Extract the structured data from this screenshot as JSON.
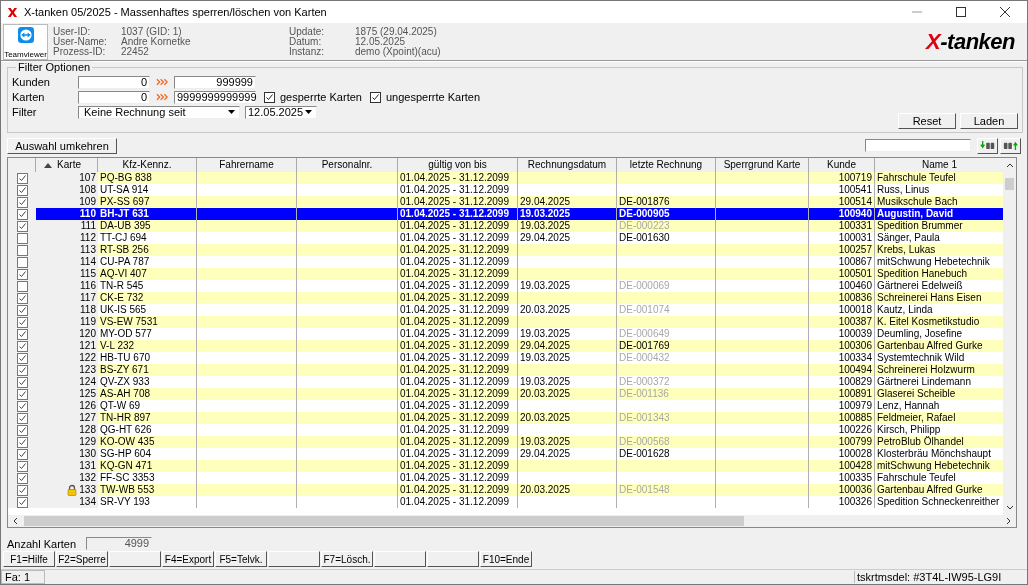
{
  "window": {
    "title": "X-tanken 05/2025 - Massenhaftes sperren/löschen von Karten"
  },
  "teamviewer": {
    "label": "Teamviewer"
  },
  "info": [
    {
      "label": "User-ID:",
      "value": "1037 (GID: 1)"
    },
    {
      "label": "User-Name:",
      "value": "Andre Kornetke"
    },
    {
      "label": "Prozess-ID:",
      "value": "22452"
    },
    {
      "label": "Update:",
      "value": "1875 (29.04.2025)"
    },
    {
      "label": "Datum:",
      "value": "12.05.2025"
    },
    {
      "label": "Instanz:",
      "value": "demo (Xpoint)(acu)"
    }
  ],
  "logo": {
    "mark": "X",
    "text": "-tanken"
  },
  "filter": {
    "title": "Filter Optionen",
    "kunden": {
      "label": "Kunden",
      "from": "0",
      "to": "999999"
    },
    "karten": {
      "label": "Karten",
      "from": "0",
      "to": "9999999999999"
    },
    "checks": [
      {
        "label": "gesperrte Karten",
        "checked": true
      },
      {
        "label": "ungesperrte Karten",
        "checked": true
      }
    ],
    "filter": {
      "label": "Filter",
      "value": "Keine Rechnung seit",
      "date": "12.05.2025"
    },
    "buttons": [
      "Reset",
      "Laden"
    ]
  },
  "invert_button": "Auswahl umkehren",
  "table": {
    "columns": [
      "Karte",
      "Kfz-Kennz.",
      "Fahrername",
      "Personalnr.",
      "gültig von bis",
      "Rechnungsdatum",
      "letzte Rechnung",
      "Sperrgrund Karte",
      "Kunde",
      "Name 1"
    ],
    "rows": [
      {
        "checked": true,
        "locked": false,
        "selected": false,
        "karte": "107",
        "kfz": "PQ-BG 838",
        "valid": "01.04.2025 - 31.12.2099",
        "kunde": "100719",
        "name": "Fahrschule Teufel"
      },
      {
        "checked": true,
        "locked": false,
        "selected": false,
        "karte": "108",
        "kfz": "UT-SA 914",
        "valid": "01.04.2025 - 31.12.2099",
        "kunde": "100541",
        "name": "Russ, Linus"
      },
      {
        "checked": true,
        "locked": false,
        "selected": false,
        "karte": "109",
        "kfz": "PX-SS 697",
        "valid": "01.04.2025 - 31.12.2099",
        "date": "29.04.2025",
        "invoice": "DE-001876",
        "stale": false,
        "kunde": "100514",
        "name": "Musikschule Bach"
      },
      {
        "checked": true,
        "locked": false,
        "selected": true,
        "karte": "110",
        "kfz": "BH-JT 631",
        "valid": "01.04.2025 - 31.12.2099",
        "date": "19.03.2025",
        "invoice": "DE-000905",
        "stale": false,
        "kunde": "100940",
        "name": "Augustin, David"
      },
      {
        "checked": true,
        "locked": false,
        "selected": false,
        "karte": "111",
        "kfz": "DA-UB 395",
        "valid": "01.04.2025 - 31.12.2099",
        "date": "19.03.2025",
        "invoice": "DE-000223",
        "stale": true,
        "kunde": "100331",
        "name": "Spedition Brummer"
      },
      {
        "checked": false,
        "locked": false,
        "selected": false,
        "karte": "112",
        "kfz": "TT-CJ 694",
        "valid": "01.04.2025 - 31.12.2099",
        "date": "29.04.2025",
        "invoice": "DE-001630",
        "stale": false,
        "kunde": "100031",
        "name": "Sänger, Paula"
      },
      {
        "checked": false,
        "locked": false,
        "selected": false,
        "karte": "113",
        "kfz": "RT-SB 256",
        "valid": "01.04.2025 - 31.12.2099",
        "kunde": "100257",
        "name": "Krebs, Lukas"
      },
      {
        "checked": false,
        "locked": false,
        "selected": false,
        "karte": "114",
        "kfz": "CU-PA 787",
        "valid": "01.04.2025 - 31.12.2099",
        "kunde": "100867",
        "name": "mitSchwung Hebetechnik"
      },
      {
        "checked": true,
        "locked": false,
        "selected": false,
        "karte": "115",
        "kfz": "AQ-VI 407",
        "valid": "01.04.2025 - 31.12.2099",
        "kunde": "100501",
        "name": "Spedition Hanebuch"
      },
      {
        "checked": false,
        "locked": false,
        "selected": false,
        "karte": "116",
        "kfz": "TN-R 545",
        "valid": "01.04.2025 - 31.12.2099",
        "date": "19.03.2025",
        "invoice": "DE-000069",
        "stale": true,
        "kunde": "100460",
        "name": "Gärtnerei Edelweiß"
      },
      {
        "checked": true,
        "locked": false,
        "selected": false,
        "karte": "117",
        "kfz": "CK-E 732",
        "valid": "01.04.2025 - 31.12.2099",
        "kunde": "100836",
        "name": "Schreinerei Hans Eisen"
      },
      {
        "checked": true,
        "locked": false,
        "selected": false,
        "karte": "118",
        "kfz": "UK-IS 565",
        "valid": "01.04.2025 - 31.12.2099",
        "date": "20.03.2025",
        "invoice": "DE-001074",
        "stale": true,
        "kunde": "100018",
        "name": "Kautz, Linda"
      },
      {
        "checked": true,
        "locked": false,
        "selected": false,
        "karte": "119",
        "kfz": "VS-EW 7531",
        "valid": "01.04.2025 - 31.12.2099",
        "kunde": "100387",
        "name": "K. Eitel Kosmetikstudio"
      },
      {
        "checked": true,
        "locked": false,
        "selected": false,
        "karte": "120",
        "kfz": "MY-OD 577",
        "valid": "01.04.2025 - 31.12.2099",
        "date": "19.03.2025",
        "invoice": "DE-000649",
        "stale": true,
        "kunde": "100039",
        "name": "Deumling, Josefine"
      },
      {
        "checked": true,
        "locked": false,
        "selected": false,
        "karte": "121",
        "kfz": "V-L 232",
        "valid": "01.04.2025 - 31.12.2099",
        "date": "29.04.2025",
        "invoice": "DE-001769",
        "stale": false,
        "kunde": "100306",
        "name": "Gartenbau Alfred Gurke"
      },
      {
        "checked": true,
        "locked": false,
        "selected": false,
        "karte": "122",
        "kfz": "HB-TU 670",
        "valid": "01.04.2025 - 31.12.2099",
        "date": "19.03.2025",
        "invoice": "DE-000432",
        "stale": true,
        "kunde": "100334",
        "name": "Systemtechnik Wild"
      },
      {
        "checked": true,
        "locked": false,
        "selected": false,
        "karte": "123",
        "kfz": "BS-ZY 671",
        "valid": "01.04.2025 - 31.12.2099",
        "kunde": "100494",
        "name": "Schreinerei Holzwurm"
      },
      {
        "checked": true,
        "locked": false,
        "selected": false,
        "karte": "124",
        "kfz": "QV-ZX 933",
        "valid": "01.04.2025 - 31.12.2099",
        "date": "19.03.2025",
        "invoice": "DE-000372",
        "stale": true,
        "kunde": "100829",
        "name": "Gärtnerei Lindemann"
      },
      {
        "checked": true,
        "locked": false,
        "selected": false,
        "karte": "125",
        "kfz": "AS-AH 708",
        "valid": "01.04.2025 - 31.12.2099",
        "date": "20.03.2025",
        "invoice": "DE-001136",
        "stale": true,
        "kunde": "100891",
        "name": "Glaserei Scheible"
      },
      {
        "checked": true,
        "locked": false,
        "selected": false,
        "karte": "126",
        "kfz": "QT-W 69",
        "valid": "01.04.2025 - 31.12.2099",
        "kunde": "100979",
        "name": "Lenz, Hannah"
      },
      {
        "checked": true,
        "locked": false,
        "selected": false,
        "karte": "127",
        "kfz": "TN-HR 897",
        "valid": "01.04.2025 - 31.12.2099",
        "date": "20.03.2025",
        "invoice": "DE-001343",
        "stale": true,
        "kunde": "100885",
        "name": "Feldmeier, Rafael"
      },
      {
        "checked": true,
        "locked": false,
        "selected": false,
        "karte": "128",
        "kfz": "QG-HT 626",
        "valid": "01.04.2025 - 31.12.2099",
        "kunde": "100226",
        "name": "Kirsch, Philipp"
      },
      {
        "checked": true,
        "locked": false,
        "selected": false,
        "karte": "129",
        "kfz": "KO-OW 435",
        "valid": "01.04.2025 - 31.12.2099",
        "date": "19.03.2025",
        "invoice": "DE-000568",
        "stale": true,
        "kunde": "100799",
        "name": "PetroBlub Ölhandel"
      },
      {
        "checked": true,
        "locked": false,
        "selected": false,
        "karte": "130",
        "kfz": "SG-HP 604",
        "valid": "01.04.2025 - 31.12.2099",
        "date": "29.04.2025",
        "invoice": "DE-001628",
        "stale": false,
        "kunde": "100028",
        "name": "Klosterbräu Mönchshaupt"
      },
      {
        "checked": true,
        "locked": false,
        "selected": false,
        "karte": "131",
        "kfz": "KQ-GN 471",
        "valid": "01.04.2025 - 31.12.2099",
        "kunde": "100428",
        "name": "mitSchwung Hebetechnik"
      },
      {
        "checked": true,
        "locked": false,
        "selected": false,
        "karte": "132",
        "kfz": "FF-SC 3353",
        "valid": "01.04.2025 - 31.12.2099",
        "kunde": "100335",
        "name": "Fahrschule Teufel"
      },
      {
        "checked": true,
        "locked": true,
        "selected": false,
        "karte": "133",
        "kfz": "TW-WB 553",
        "valid": "01.04.2025 - 31.12.2099",
        "date": "20.03.2025",
        "invoice": "DE-001548",
        "stale": true,
        "kunde": "100036",
        "name": "Gartenbau Alfred Gurke"
      },
      {
        "checked": true,
        "locked": false,
        "selected": false,
        "karte": "134",
        "kfz": "SR-VY 193",
        "valid": "01.04.2025 - 31.12.2099",
        "kunde": "100326",
        "name": "Spedition Schneckenreither"
      }
    ]
  },
  "count": {
    "label": "Anzahl Karten",
    "value": "4999"
  },
  "fkeys": [
    {
      "kind": "key",
      "label": "F1=Hilfe"
    },
    {
      "kind": "key",
      "label": "F2=Sperre"
    },
    {
      "kind": "blank"
    },
    {
      "kind": "key",
      "label": "F4=Export"
    },
    {
      "kind": "key",
      "label": "F5=Telvk."
    },
    {
      "kind": "blank"
    },
    {
      "kind": "key",
      "label": "F7=Lösch."
    },
    {
      "kind": "blank"
    },
    {
      "kind": "blank"
    },
    {
      "kind": "key",
      "label": "F10=Ende"
    }
  ],
  "status_bar": {
    "left": "Fa: 1",
    "right": "tskrtmsdel: #3T4L-IW95-LG9I"
  }
}
